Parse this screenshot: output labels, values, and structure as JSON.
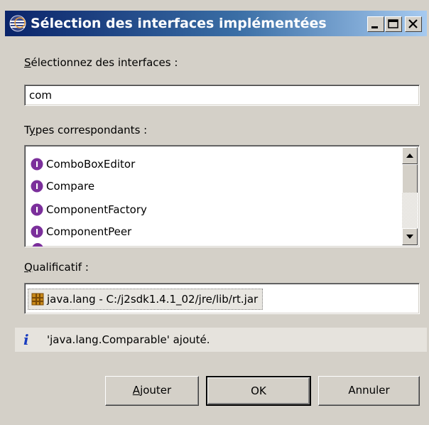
{
  "window": {
    "title": "Sélection des interfaces implémentées",
    "minimize_icon": "minimize-icon",
    "maximize_icon": "maximize-icon",
    "close_icon": "close-icon"
  },
  "search": {
    "label_mnemonic": "S",
    "label_rest": "électionnez des interfaces :",
    "value": "com"
  },
  "types": {
    "label_pre": "T",
    "label_mnemonic": "y",
    "label_rest": "pes correspondants :",
    "items": [
      {
        "label": "ComboBoxEditor",
        "icon": "interface-icon"
      },
      {
        "label": "Compare",
        "icon": "interface-icon"
      },
      {
        "label": "ComponentFactory",
        "icon": "interface-icon"
      },
      {
        "label": "ComponentPeer",
        "icon": "interface-icon"
      }
    ]
  },
  "qualifier": {
    "label_mnemonic": "Q",
    "label_rest": "ualificatif :",
    "value": "java.lang - C:/j2sdk1.4.1_02/jre/lib/rt.jar",
    "icon": "package-icon"
  },
  "status": {
    "icon": "info-icon",
    "glyph": "i",
    "text": "'java.lang.Comparable' ajouté."
  },
  "buttons": {
    "add_mnemonic": "A",
    "add_rest": "jouter",
    "ok": "OK",
    "cancel": "Annuler"
  },
  "colors": {
    "titlebar_start": "#0a246a",
    "titlebar_end": "#a6caf0",
    "dialog_bg": "#d4d0c8",
    "interface_icon": "#7b2f9b",
    "info_icon": "#1a3dbf"
  }
}
